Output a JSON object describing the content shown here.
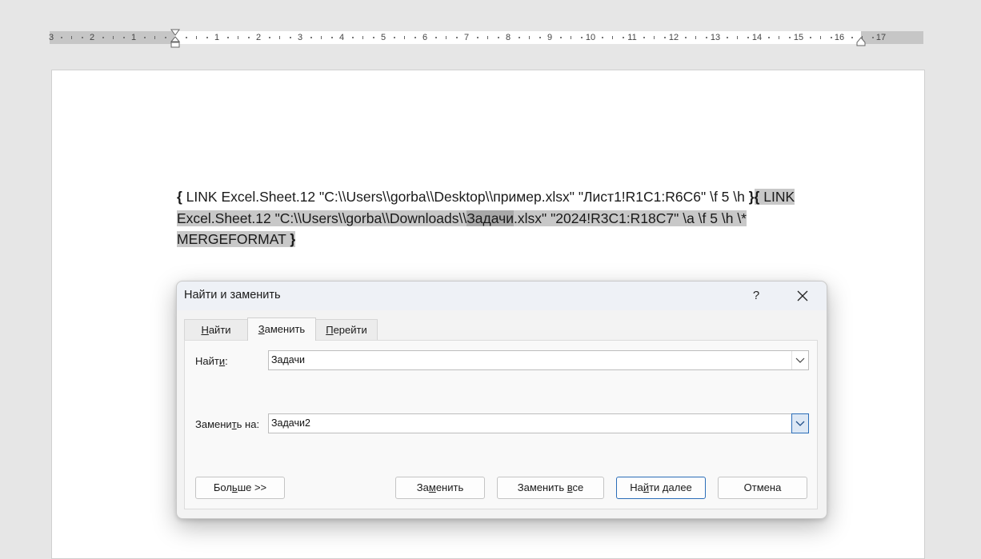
{
  "ruler": {
    "left_numbers": [
      "3",
      "2",
      "1"
    ],
    "right_numbers": [
      "1",
      "2",
      "3",
      "4",
      "5",
      "6",
      "7",
      "8",
      "9",
      "10",
      "11",
      "12",
      "13",
      "14",
      "15",
      "16",
      "17"
    ]
  },
  "document": {
    "brace_open_1": "{",
    "part1": " LINK Excel.Sheet.12 \"C:\\\\Users\\\\gorba\\\\Desktop\\\\пример.xlsx\" \"Лист1!R1C1:R6C6\" \\f 5 \\h ",
    "brace_close_1": "}",
    "brace_open_2": "{",
    "part2a": " LINK Excel.Sheet.12 \"C:\\\\Users\\\\gorba\\\\Downloads\\\\",
    "match": "Задачи",
    "part2b": ".xlsx\" \"2024!R3C1:R18C7\" \\a \\f 5 \\h  \\* MERGEFORMAT ",
    "brace_close_2": "}"
  },
  "dialog": {
    "title": "Найти и заменить",
    "help": "?",
    "tabs": [
      {
        "pre": "",
        "ul": "Н",
        "post": "айти"
      },
      {
        "pre": "",
        "ul": "З",
        "post": "аменить"
      },
      {
        "pre": "",
        "ul": "П",
        "post": "ерейти"
      }
    ],
    "active_tab": "Заменить",
    "find_label": {
      "pre": "Найт",
      "ul": "и",
      "post": ":"
    },
    "find_value": "Задачи",
    "replace_label": {
      "pre": "Замени",
      "ul": "т",
      "post": "ь на:"
    },
    "replace_value": "Задачи2",
    "buttons": {
      "more": {
        "pre": "Бол",
        "ul": "ь",
        "post": "ше >>"
      },
      "replace": {
        "pre": "За",
        "ul": "м",
        "post": "енить"
      },
      "replace_all": {
        "pre": "Заменить ",
        "ul": "в",
        "post": "се"
      },
      "find_next": {
        "pre": "На",
        "ul": "й",
        "post": "ти далее"
      },
      "cancel": "Отмена"
    }
  },
  "colors": {
    "field_shading": "#c8c8c8",
    "match_highlight": "#a8a8a8",
    "focus_accent": "#2b6db8"
  }
}
